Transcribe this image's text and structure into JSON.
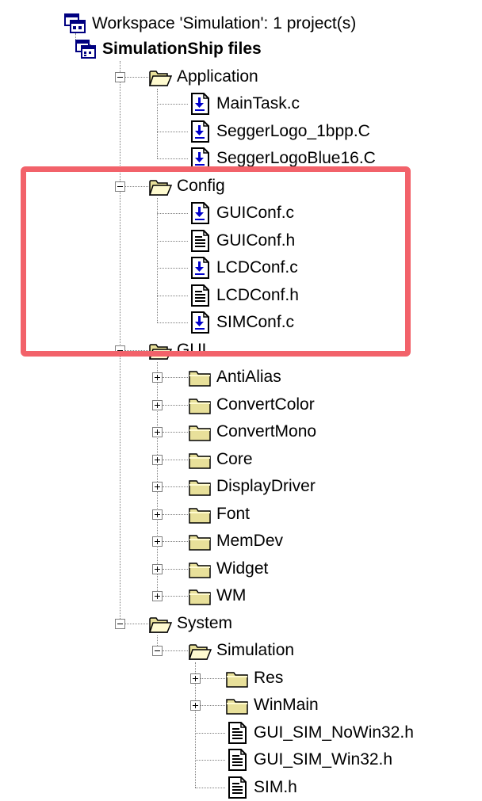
{
  "workspace": {
    "title": "Workspace 'Simulation': 1 project(s)"
  },
  "colors": {
    "highlight": "#f2626a",
    "folder": "#e8e09a",
    "file_blue": "#0000cc"
  },
  "tree": [
    {
      "label": "SimulationShip files",
      "icon": "project-icon",
      "depth": 0,
      "expanded": true,
      "bold": true
    },
    {
      "label": "Application",
      "icon": "folder-open-icon",
      "depth": 1,
      "expanded": true
    },
    {
      "label": "MainTask.c",
      "icon": "c-source-file-icon",
      "depth": 2
    },
    {
      "label": "SeggerLogo_1bpp.C",
      "icon": "c-source-file-icon",
      "depth": 2
    },
    {
      "label": "SeggerLogoBlue16.C",
      "icon": "c-source-file-icon",
      "depth": 2
    },
    {
      "label": "Config",
      "icon": "folder-open-icon",
      "depth": 1,
      "expanded": true
    },
    {
      "label": "GUIConf.c",
      "icon": "c-source-file-icon",
      "depth": 2
    },
    {
      "label": "GUIConf.h",
      "icon": "header-file-icon",
      "depth": 2
    },
    {
      "label": "LCDConf.c",
      "icon": "c-source-file-icon",
      "depth": 2
    },
    {
      "label": "LCDConf.h",
      "icon": "header-file-icon",
      "depth": 2
    },
    {
      "label": "SIMConf.c",
      "icon": "c-source-file-icon",
      "depth": 2
    },
    {
      "label": "GUI",
      "icon": "folder-open-icon",
      "depth": 1,
      "expanded": true
    },
    {
      "label": "AntiAlias",
      "icon": "folder-closed-icon",
      "depth": 2,
      "expanded": false
    },
    {
      "label": "ConvertColor",
      "icon": "folder-closed-icon",
      "depth": 2,
      "expanded": false
    },
    {
      "label": "ConvertMono",
      "icon": "folder-closed-icon",
      "depth": 2,
      "expanded": false
    },
    {
      "label": "Core",
      "icon": "folder-closed-icon",
      "depth": 2,
      "expanded": false
    },
    {
      "label": "DisplayDriver",
      "icon": "folder-closed-icon",
      "depth": 2,
      "expanded": false
    },
    {
      "label": "Font",
      "icon": "folder-closed-icon",
      "depth": 2,
      "expanded": false
    },
    {
      "label": "MemDev",
      "icon": "folder-closed-icon",
      "depth": 2,
      "expanded": false
    },
    {
      "label": "Widget",
      "icon": "folder-closed-icon",
      "depth": 2,
      "expanded": false
    },
    {
      "label": "WM",
      "icon": "folder-closed-icon",
      "depth": 2,
      "expanded": false
    },
    {
      "label": "System",
      "icon": "folder-open-icon",
      "depth": 1,
      "expanded": true
    },
    {
      "label": "Simulation",
      "icon": "folder-open-icon",
      "depth": 2,
      "expanded": true
    },
    {
      "label": "Res",
      "icon": "folder-closed-icon",
      "depth": 3,
      "expanded": false
    },
    {
      "label": "WinMain",
      "icon": "folder-closed-icon",
      "depth": 3,
      "expanded": false
    },
    {
      "label": "GUI_SIM_NoWin32.h",
      "icon": "header-file-icon",
      "depth": 3
    },
    {
      "label": "GUI_SIM_Win32.h",
      "icon": "header-file-icon",
      "depth": 3
    },
    {
      "label": "SIM.h",
      "icon": "header-file-icon",
      "depth": 3
    }
  ]
}
